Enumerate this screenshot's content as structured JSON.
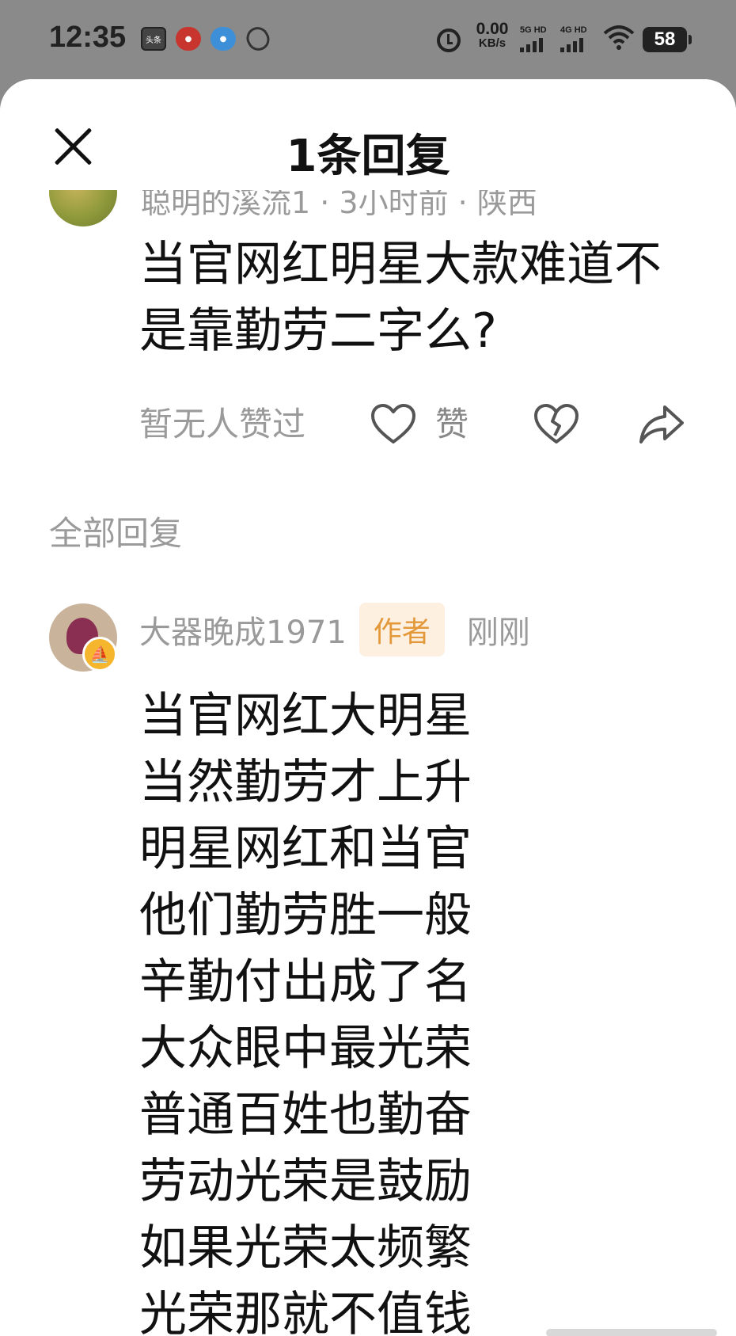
{
  "status_bar": {
    "time": "12:35",
    "net_speed_value": "0.00",
    "net_speed_unit": "KB/s",
    "sim1": "5G HD",
    "sim2": "4G HD",
    "battery": "58",
    "icons": [
      "news-app-icon",
      "app-icon-red",
      "app-icon-blue",
      "link-app-icon",
      "alarm-icon",
      "signal-icon",
      "wifi-icon",
      "battery-icon"
    ]
  },
  "sheet": {
    "title": "1条回复"
  },
  "parent_comment": {
    "meta": "聪明的溪流1 · 3小时前 · 陕西",
    "text": "当官网红明星大款难道不是靠勤劳二字么?",
    "liked_status": "暂无人赞过",
    "like_label": "赞"
  },
  "section": {
    "all_replies": "全部回复"
  },
  "reply": {
    "author": "大器晚成1971",
    "author_tag": "作者",
    "time": "刚刚",
    "lines": [
      "当官网红大明星",
      "当然勤劳才上升",
      "明星网红和当官",
      "他们勤劳胜一般",
      "辛勤付出成了名",
      "大众眼中最光荣",
      "普通百姓也勤奋",
      "劳动光荣是鼓励",
      "如果光荣太频繁",
      "光荣那就不值钱"
    ]
  }
}
